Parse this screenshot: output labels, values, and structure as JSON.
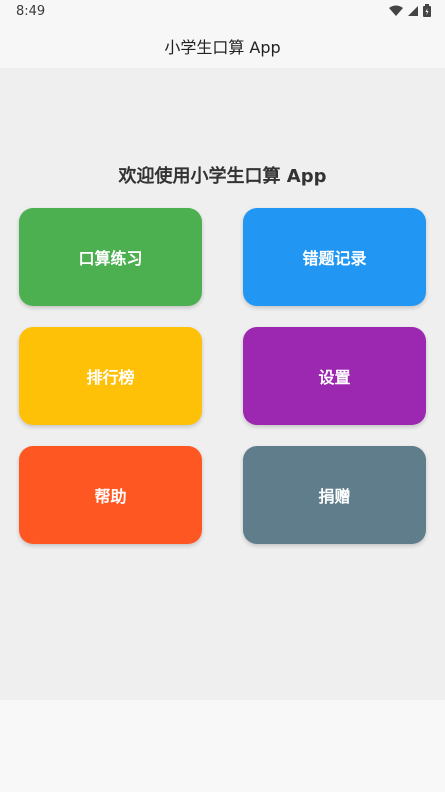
{
  "status_bar": {
    "time": "8:49"
  },
  "app_bar": {
    "title": "小学生口算 App"
  },
  "welcome_text": "欢迎使用小学生口算 App",
  "tiles": [
    {
      "label": "口算练习",
      "color": "#4CAF50"
    },
    {
      "label": "错题记录",
      "color": "#2196F3"
    },
    {
      "label": "排行榜",
      "color": "#FFC107"
    },
    {
      "label": "设置",
      "color": "#9C27B0"
    },
    {
      "label": "帮助",
      "color": "#FF5722"
    },
    {
      "label": "捐赠",
      "color": "#607D8B"
    }
  ]
}
